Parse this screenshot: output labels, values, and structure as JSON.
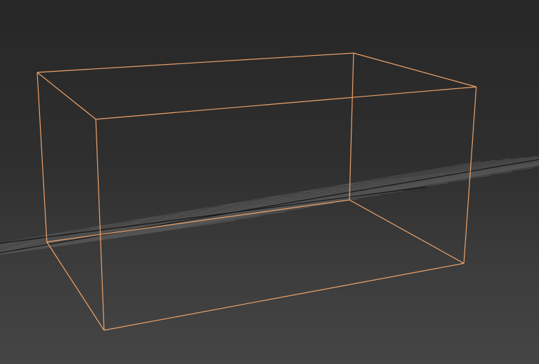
{
  "viewport": {
    "view": "perspective",
    "grid_visible": true,
    "selected_object": "box",
    "colors": {
      "background_top": "#272727",
      "background_bottom": "#454545",
      "grid_line": "#5a5a5a",
      "grid_axis": "#141414",
      "selection_wireframe": "#f0a46a"
    }
  }
}
